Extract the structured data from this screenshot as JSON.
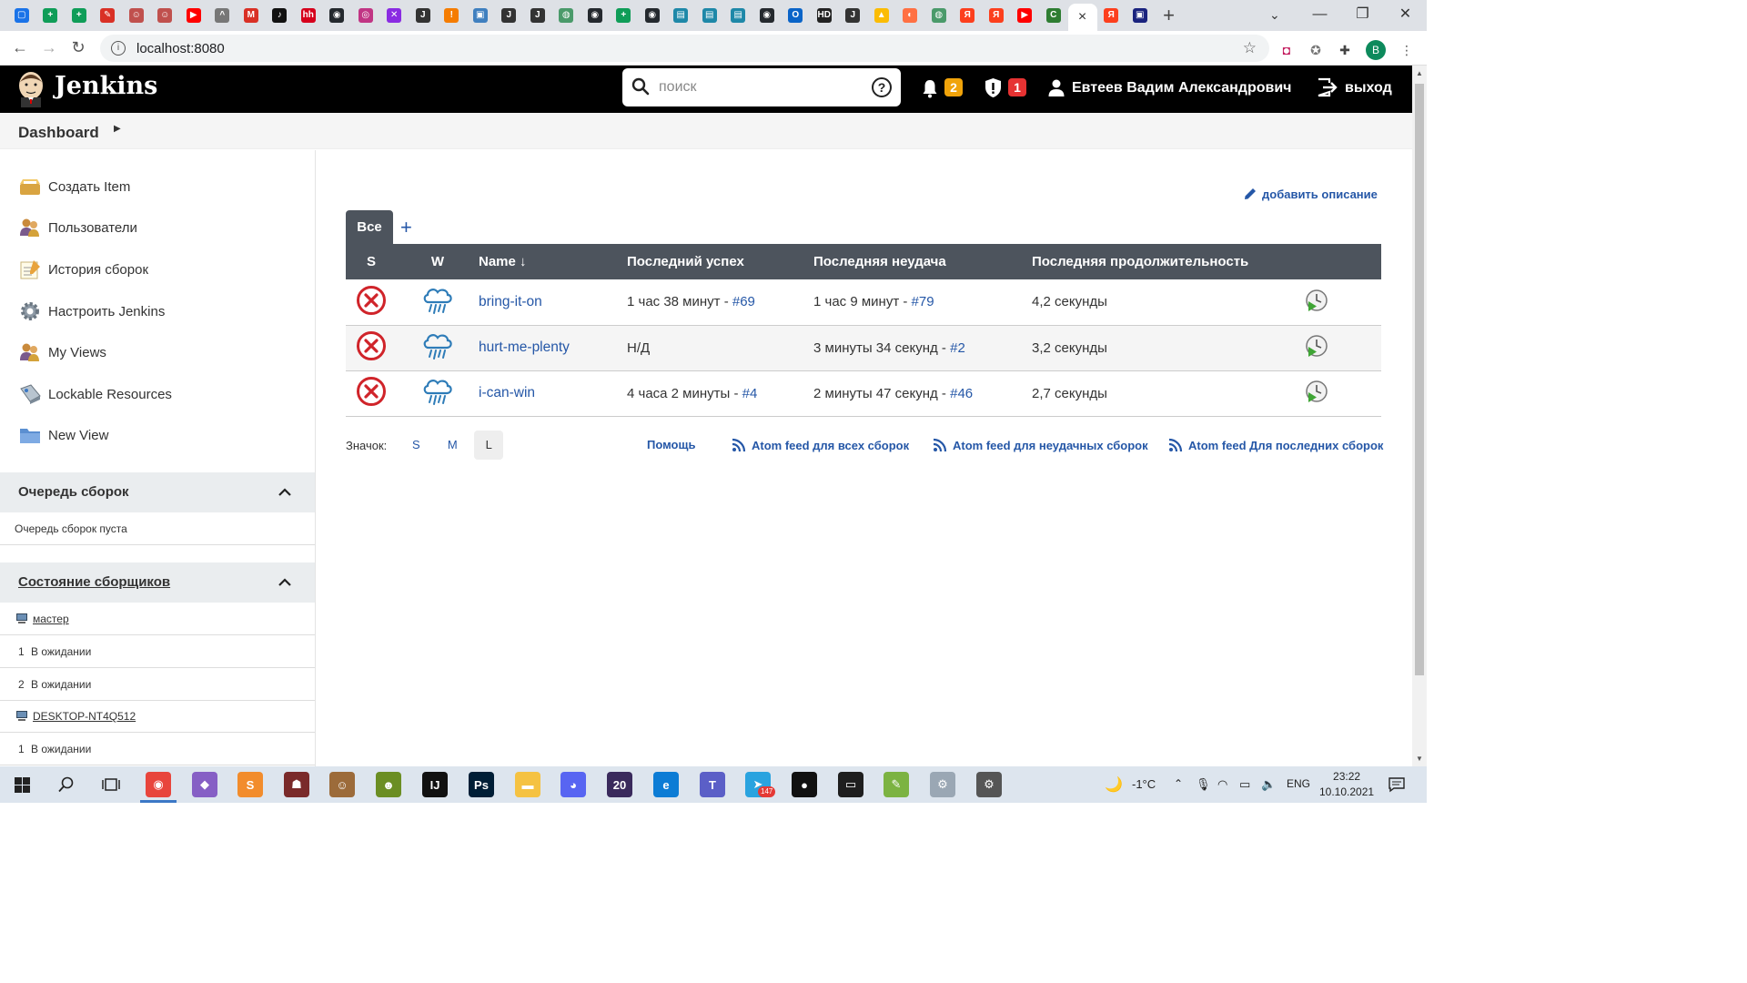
{
  "browser": {
    "url": "localhost:8080",
    "tab_close": "×",
    "new_tab": "+",
    "profile_letter": "B",
    "favicons": [
      {
        "name": "chat-favicon",
        "color": "#1a73e8",
        "glyph": "▢"
      },
      {
        "name": "sheets-favicon",
        "color": "#0f9d58",
        "glyph": "+"
      },
      {
        "name": "sheets-favicon",
        "color": "#0f9d58",
        "glyph": "+"
      },
      {
        "name": "app-favicon",
        "color": "#d93025",
        "glyph": "✎"
      },
      {
        "name": "avatar-favicon",
        "color": "#c0504d",
        "glyph": "☺"
      },
      {
        "name": "avatar-favicon",
        "color": "#c0504d",
        "glyph": "☺"
      },
      {
        "name": "youtube-favicon",
        "color": "#ff0000",
        "glyph": "▶"
      },
      {
        "name": "hat-favicon",
        "color": "#777777",
        "glyph": "^"
      },
      {
        "name": "gmail-favicon",
        "color": "#d93025",
        "glyph": "M"
      },
      {
        "name": "tiktok-favicon",
        "color": "#111111",
        "glyph": "♪"
      },
      {
        "name": "hh-favicon",
        "color": "#d6001c",
        "glyph": "hh"
      },
      {
        "name": "github-favicon",
        "color": "#24292e",
        "glyph": "◉"
      },
      {
        "name": "instagram-favicon",
        "color": "#c13584",
        "glyph": "◎"
      },
      {
        "name": "tools-favicon",
        "color": "#8a2be2",
        "glyph": "✕"
      },
      {
        "name": "jenkins-favicon",
        "color": "#333333",
        "glyph": "J"
      },
      {
        "name": "orange-favicon",
        "color": "#f57c00",
        "glyph": "!"
      },
      {
        "name": "picture-favicon",
        "color": "#3f7fbf",
        "glyph": "▣"
      },
      {
        "name": "jenkins-favicon",
        "color": "#333333",
        "glyph": "J"
      },
      {
        "name": "jenkins-favicon",
        "color": "#333333",
        "glyph": "J"
      },
      {
        "name": "pin-favicon",
        "color": "#4a9a6a",
        "glyph": "◍"
      },
      {
        "name": "github-favicon",
        "color": "#24292e",
        "glyph": "◉"
      },
      {
        "name": "sheets-favicon",
        "color": "#0f9d58",
        "glyph": "+"
      },
      {
        "name": "github-favicon",
        "color": "#24292e",
        "glyph": "◉"
      },
      {
        "name": "book-favicon",
        "color": "#1e88a8",
        "glyph": "▤"
      },
      {
        "name": "book-favicon",
        "color": "#1e88a8",
        "glyph": "▤"
      },
      {
        "name": "book-favicon",
        "color": "#1e88a8",
        "glyph": "▤"
      },
      {
        "name": "github-favicon",
        "color": "#24292e",
        "glyph": "◉"
      },
      {
        "name": "outlook-favicon",
        "color": "#0a64c8",
        "glyph": "O"
      },
      {
        "name": "hd-favicon",
        "color": "#222222",
        "glyph": "HD"
      },
      {
        "name": "jenkins-favicon",
        "color": "#333333",
        "glyph": "J"
      },
      {
        "name": "drive-favicon",
        "color": "#fbbc04",
        "glyph": "▲"
      },
      {
        "name": "orange-favicon",
        "color": "#ff7043",
        "glyph": "◐"
      },
      {
        "name": "pin-favicon",
        "color": "#4a9a6a",
        "glyph": "◍"
      },
      {
        "name": "yandex-favicon",
        "color": "#fc3f1d",
        "glyph": "Я"
      },
      {
        "name": "yandex-favicon",
        "color": "#fc3f1d",
        "glyph": "Я"
      },
      {
        "name": "youtube-favicon",
        "color": "#ff0000",
        "glyph": "▶"
      },
      {
        "name": "green-favicon",
        "color": "#2e7d32",
        "glyph": "C"
      }
    ],
    "after_active": [
      {
        "name": "yandex-favicon",
        "color": "#fc3f1d",
        "glyph": "Я"
      },
      {
        "name": "monitor-favicon",
        "color": "#1a237e",
        "glyph": "▣"
      }
    ]
  },
  "header": {
    "title": "Jenkins",
    "search_placeholder": "поиск",
    "help_glyph": "?",
    "notifications_count": "2",
    "security_count": "1",
    "user_name": "Евтеев Вадим Александрович",
    "logout_label": "выход",
    "notification_color": "#f0a30a",
    "security_color": "#e63232"
  },
  "breadcrumb": {
    "dashboard": "Dashboard"
  },
  "sidebar": {
    "tasks": [
      {
        "label": "Создать Item"
      },
      {
        "label": "Пользователи"
      },
      {
        "label": "История сборок"
      },
      {
        "label": "Настроить Jenkins"
      },
      {
        "label": "My Views"
      },
      {
        "label": "Lockable Resources"
      },
      {
        "label": "New View"
      }
    ],
    "queue": {
      "title": "Очередь сборок",
      "empty": "Очередь сборок пуста"
    },
    "executors": {
      "title": "Состояние сборщиков",
      "nodes": [
        {
          "name": "мастер",
          "slots": [
            {
              "num": "1",
              "status": "В ожидании"
            },
            {
              "num": "2",
              "status": "В ожидании"
            }
          ]
        },
        {
          "name": "DESKTOP-NT4Q512",
          "slots": [
            {
              "num": "1",
              "status": "В ожидании"
            }
          ]
        }
      ]
    }
  },
  "main": {
    "add_description": "добавить описание",
    "view_tab": "Все",
    "add_view": "+",
    "columns": {
      "s": "S",
      "w": "W",
      "name": "Name ↓",
      "last_success": "Последний успех",
      "last_failure": "Последняя неудача",
      "last_duration": "Последняя продолжительность"
    },
    "jobs": [
      {
        "name": "bring-it-on",
        "ls_text": "1 час 38 минут - ",
        "ls_link": "#69",
        "lf_text": "1 час 9 минут - ",
        "lf_link": "#79",
        "duration": "4,2 секунды"
      },
      {
        "name": "hurt-me-plenty",
        "ls_text": "Н/Д",
        "ls_link": "",
        "lf_text": "3 минуты 34 секунд - ",
        "lf_link": "#2",
        "duration": "3,2 секунды"
      },
      {
        "name": "i-can-win",
        "ls_text": "4 часа 2 минуты - ",
        "ls_link": "#4",
        "lf_text": "2 минуты 47 секунд - ",
        "lf_link": "#46",
        "duration": "2,7 секунды"
      }
    ],
    "icon_label": "Значок:",
    "sizes": [
      "S",
      "M",
      "L"
    ],
    "selected_size": "L",
    "links": {
      "help": "Помощь",
      "feed_all": "Atom feed для всех сборок",
      "feed_failed": "Atom feed для неудачных сборок",
      "feed_latest": "Atom feed Для последних сборок"
    }
  },
  "taskbar": {
    "weather": "-1°C",
    "lang": "ENG",
    "time": "23:22",
    "date": "10.10.2021",
    "telegram_badge": "147",
    "app_20": "20"
  }
}
